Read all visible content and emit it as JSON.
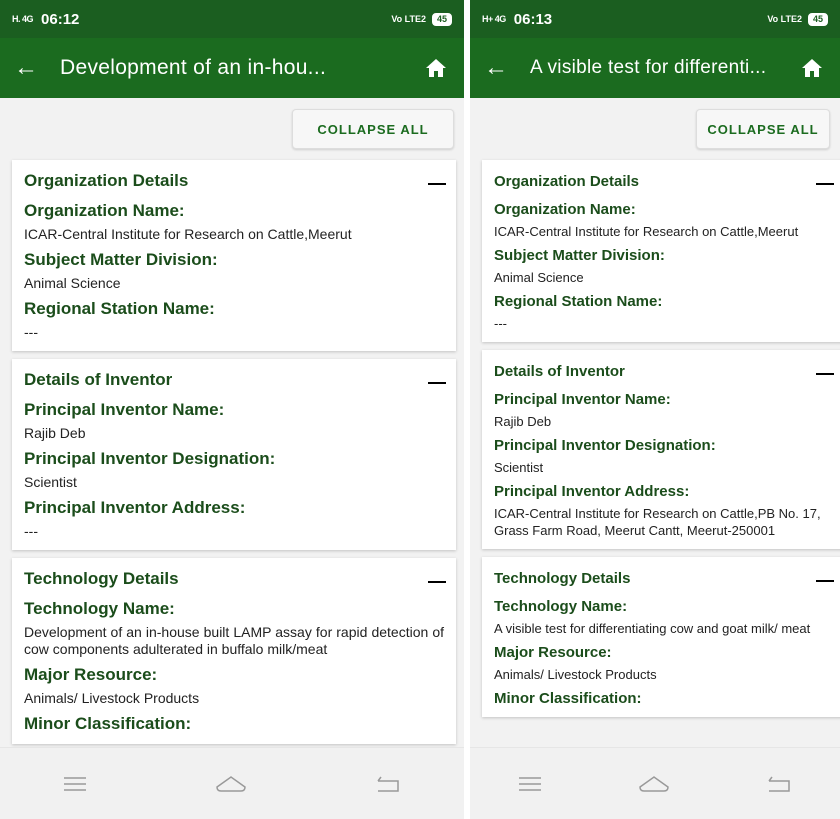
{
  "left": {
    "status": {
      "signal": "H. 4G",
      "time": "06:12",
      "right_icons": "Vo LTE2",
      "battery": "45"
    },
    "appbar": {
      "title": "Development of an in-hou..."
    },
    "collapse_label": "COLLAPSE ALL",
    "cards": [
      {
        "title": "Organization Details",
        "fields": [
          {
            "label": "Organization Name:",
            "value": "ICAR-Central Institute for Research on Cattle,Meerut"
          },
          {
            "label": "Subject Matter Division:",
            "value": "Animal Science"
          },
          {
            "label": "Regional Station Name:",
            "value": "---"
          }
        ]
      },
      {
        "title": "Details of Inventor",
        "fields": [
          {
            "label": "Principal Inventor Name:",
            "value": "Rajib Deb"
          },
          {
            "label": "Principal Inventor Designation:",
            "value": "Scientist"
          },
          {
            "label": "Principal Inventor Address:",
            "value": "---"
          }
        ]
      },
      {
        "title": "Technology Details",
        "fields": [
          {
            "label": "Technology Name:",
            "value": "Development of an in-house built LAMP assay for rapid detection of cow components adulterated in buffalo milk/meat"
          },
          {
            "label": "Major Resource:",
            "value": "Animals/ Livestock Products"
          },
          {
            "label": "Minor Classification:",
            "value": ""
          }
        ]
      }
    ]
  },
  "right": {
    "status": {
      "signal": "H+ 4G",
      "time": "06:13",
      "right_icons": "Vo LTE2",
      "battery": "45"
    },
    "appbar": {
      "title": "A visible test for differenti..."
    },
    "collapse_label": "COLLAPSE ALL",
    "cards": [
      {
        "title": "Organization Details",
        "fields": [
          {
            "label": "Organization Name:",
            "value": "ICAR-Central Institute for Research on Cattle,Meerut"
          },
          {
            "label": "Subject Matter Division:",
            "value": "Animal Science"
          },
          {
            "label": "Regional Station Name:",
            "value": "---"
          }
        ]
      },
      {
        "title": "Details of Inventor",
        "fields": [
          {
            "label": "Principal Inventor Name:",
            "value": "Rajib Deb"
          },
          {
            "label": "Principal Inventor Designation:",
            "value": "Scientist"
          },
          {
            "label": "Principal Inventor Address:",
            "value": "ICAR-Central Institute for Research on Cattle,PB No. 17, Grass Farm Road, Meerut Cantt, Meerut-250001"
          }
        ]
      },
      {
        "title": "Technology Details",
        "fields": [
          {
            "label": "Technology Name:",
            "value": "A visible test for differentiating cow and goat milk/ meat"
          },
          {
            "label": "Major Resource:",
            "value": "Animals/ Livestock Products"
          },
          {
            "label": "Minor Classification:",
            "value": ""
          }
        ]
      }
    ]
  },
  "icons": {
    "back": "arrow-left-icon",
    "home": "home-icon",
    "collapse_card": "minus-icon",
    "nav_menu": "menu-icon",
    "nav_home": "home-nav-icon",
    "nav_back": "back-nav-icon"
  },
  "colors": {
    "appbar": "#1b6b1f",
    "statusbar": "#1b5e20",
    "heading": "#1b4d1b"
  }
}
